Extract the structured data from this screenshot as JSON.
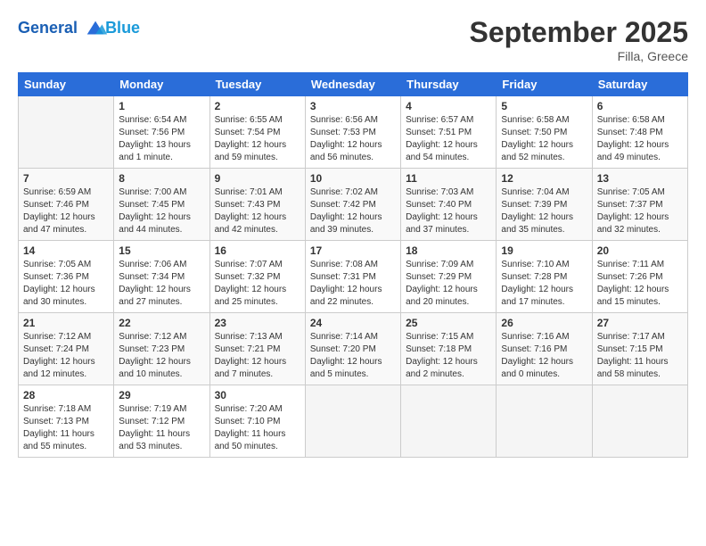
{
  "header": {
    "logo_line1": "General",
    "logo_line2": "Blue",
    "month": "September 2025",
    "location": "Filla, Greece"
  },
  "weekdays": [
    "Sunday",
    "Monday",
    "Tuesday",
    "Wednesday",
    "Thursday",
    "Friday",
    "Saturday"
  ],
  "weeks": [
    [
      {
        "day": "",
        "info": ""
      },
      {
        "day": "1",
        "info": "Sunrise: 6:54 AM\nSunset: 7:56 PM\nDaylight: 13 hours\nand 1 minute."
      },
      {
        "day": "2",
        "info": "Sunrise: 6:55 AM\nSunset: 7:54 PM\nDaylight: 12 hours\nand 59 minutes."
      },
      {
        "day": "3",
        "info": "Sunrise: 6:56 AM\nSunset: 7:53 PM\nDaylight: 12 hours\nand 56 minutes."
      },
      {
        "day": "4",
        "info": "Sunrise: 6:57 AM\nSunset: 7:51 PM\nDaylight: 12 hours\nand 54 minutes."
      },
      {
        "day": "5",
        "info": "Sunrise: 6:58 AM\nSunset: 7:50 PM\nDaylight: 12 hours\nand 52 minutes."
      },
      {
        "day": "6",
        "info": "Sunrise: 6:58 AM\nSunset: 7:48 PM\nDaylight: 12 hours\nand 49 minutes."
      }
    ],
    [
      {
        "day": "7",
        "info": "Sunrise: 6:59 AM\nSunset: 7:46 PM\nDaylight: 12 hours\nand 47 minutes."
      },
      {
        "day": "8",
        "info": "Sunrise: 7:00 AM\nSunset: 7:45 PM\nDaylight: 12 hours\nand 44 minutes."
      },
      {
        "day": "9",
        "info": "Sunrise: 7:01 AM\nSunset: 7:43 PM\nDaylight: 12 hours\nand 42 minutes."
      },
      {
        "day": "10",
        "info": "Sunrise: 7:02 AM\nSunset: 7:42 PM\nDaylight: 12 hours\nand 39 minutes."
      },
      {
        "day": "11",
        "info": "Sunrise: 7:03 AM\nSunset: 7:40 PM\nDaylight: 12 hours\nand 37 minutes."
      },
      {
        "day": "12",
        "info": "Sunrise: 7:04 AM\nSunset: 7:39 PM\nDaylight: 12 hours\nand 35 minutes."
      },
      {
        "day": "13",
        "info": "Sunrise: 7:05 AM\nSunset: 7:37 PM\nDaylight: 12 hours\nand 32 minutes."
      }
    ],
    [
      {
        "day": "14",
        "info": "Sunrise: 7:05 AM\nSunset: 7:36 PM\nDaylight: 12 hours\nand 30 minutes."
      },
      {
        "day": "15",
        "info": "Sunrise: 7:06 AM\nSunset: 7:34 PM\nDaylight: 12 hours\nand 27 minutes."
      },
      {
        "day": "16",
        "info": "Sunrise: 7:07 AM\nSunset: 7:32 PM\nDaylight: 12 hours\nand 25 minutes."
      },
      {
        "day": "17",
        "info": "Sunrise: 7:08 AM\nSunset: 7:31 PM\nDaylight: 12 hours\nand 22 minutes."
      },
      {
        "day": "18",
        "info": "Sunrise: 7:09 AM\nSunset: 7:29 PM\nDaylight: 12 hours\nand 20 minutes."
      },
      {
        "day": "19",
        "info": "Sunrise: 7:10 AM\nSunset: 7:28 PM\nDaylight: 12 hours\nand 17 minutes."
      },
      {
        "day": "20",
        "info": "Sunrise: 7:11 AM\nSunset: 7:26 PM\nDaylight: 12 hours\nand 15 minutes."
      }
    ],
    [
      {
        "day": "21",
        "info": "Sunrise: 7:12 AM\nSunset: 7:24 PM\nDaylight: 12 hours\nand 12 minutes."
      },
      {
        "day": "22",
        "info": "Sunrise: 7:12 AM\nSunset: 7:23 PM\nDaylight: 12 hours\nand 10 minutes."
      },
      {
        "day": "23",
        "info": "Sunrise: 7:13 AM\nSunset: 7:21 PM\nDaylight: 12 hours\nand 7 minutes."
      },
      {
        "day": "24",
        "info": "Sunrise: 7:14 AM\nSunset: 7:20 PM\nDaylight: 12 hours\nand 5 minutes."
      },
      {
        "day": "25",
        "info": "Sunrise: 7:15 AM\nSunset: 7:18 PM\nDaylight: 12 hours\nand 2 minutes."
      },
      {
        "day": "26",
        "info": "Sunrise: 7:16 AM\nSunset: 7:16 PM\nDaylight: 12 hours\nand 0 minutes."
      },
      {
        "day": "27",
        "info": "Sunrise: 7:17 AM\nSunset: 7:15 PM\nDaylight: 11 hours\nand 58 minutes."
      }
    ],
    [
      {
        "day": "28",
        "info": "Sunrise: 7:18 AM\nSunset: 7:13 PM\nDaylight: 11 hours\nand 55 minutes."
      },
      {
        "day": "29",
        "info": "Sunrise: 7:19 AM\nSunset: 7:12 PM\nDaylight: 11 hours\nand 53 minutes."
      },
      {
        "day": "30",
        "info": "Sunrise: 7:20 AM\nSunset: 7:10 PM\nDaylight: 11 hours\nand 50 minutes."
      },
      {
        "day": "",
        "info": ""
      },
      {
        "day": "",
        "info": ""
      },
      {
        "day": "",
        "info": ""
      },
      {
        "day": "",
        "info": ""
      }
    ]
  ]
}
